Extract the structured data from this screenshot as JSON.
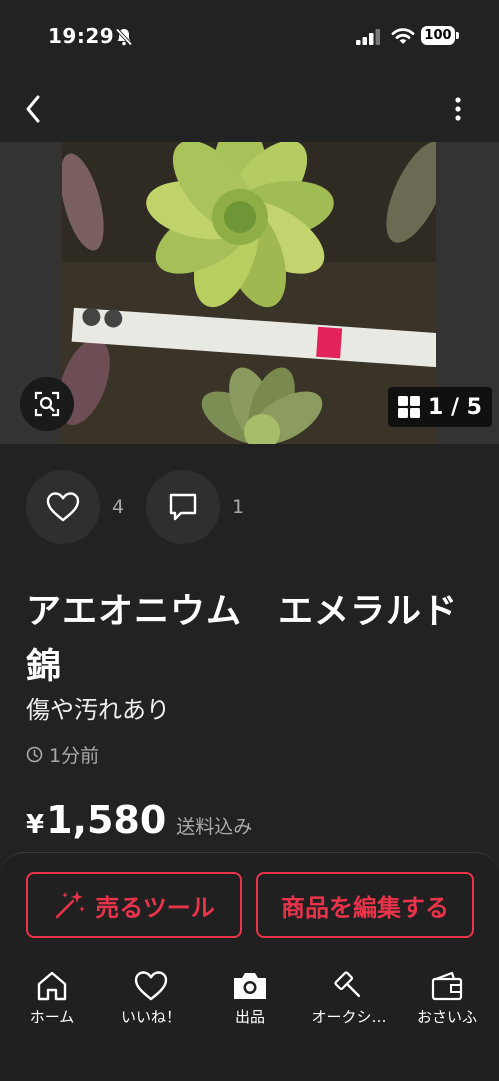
{
  "status_bar": {
    "time": "19:29",
    "battery": "100"
  },
  "nav": {
    "back_icon": "chevron-left-icon",
    "more_icon": "more-vertical-icon"
  },
  "gallery": {
    "counter": "1 / 5",
    "lens_icon": "image-search-icon",
    "grid_icon": "grid-icon"
  },
  "actions": {
    "likes": "4",
    "comments": "1"
  },
  "product": {
    "title": "アエオニウム　エメラルド錦",
    "condition": "傷や汚れあり",
    "posted": "1分前",
    "price_symbol": "¥",
    "price": "1,580",
    "price_note": "送料込み"
  },
  "buttons": {
    "sell_tools": "売るツール",
    "edit_item": "商品を編集する"
  },
  "tabs": [
    {
      "label": "ホーム",
      "icon": "home-icon"
    },
    {
      "label": "いいね！",
      "icon": "heart-icon"
    },
    {
      "label": "出品",
      "icon": "camera-icon"
    },
    {
      "label": "オークシ…",
      "icon": "auction-hammer-icon"
    },
    {
      "label": "おさいふ",
      "icon": "wallet-icon"
    }
  ],
  "colors": {
    "accent": "#e8334a",
    "background": "#222222"
  }
}
